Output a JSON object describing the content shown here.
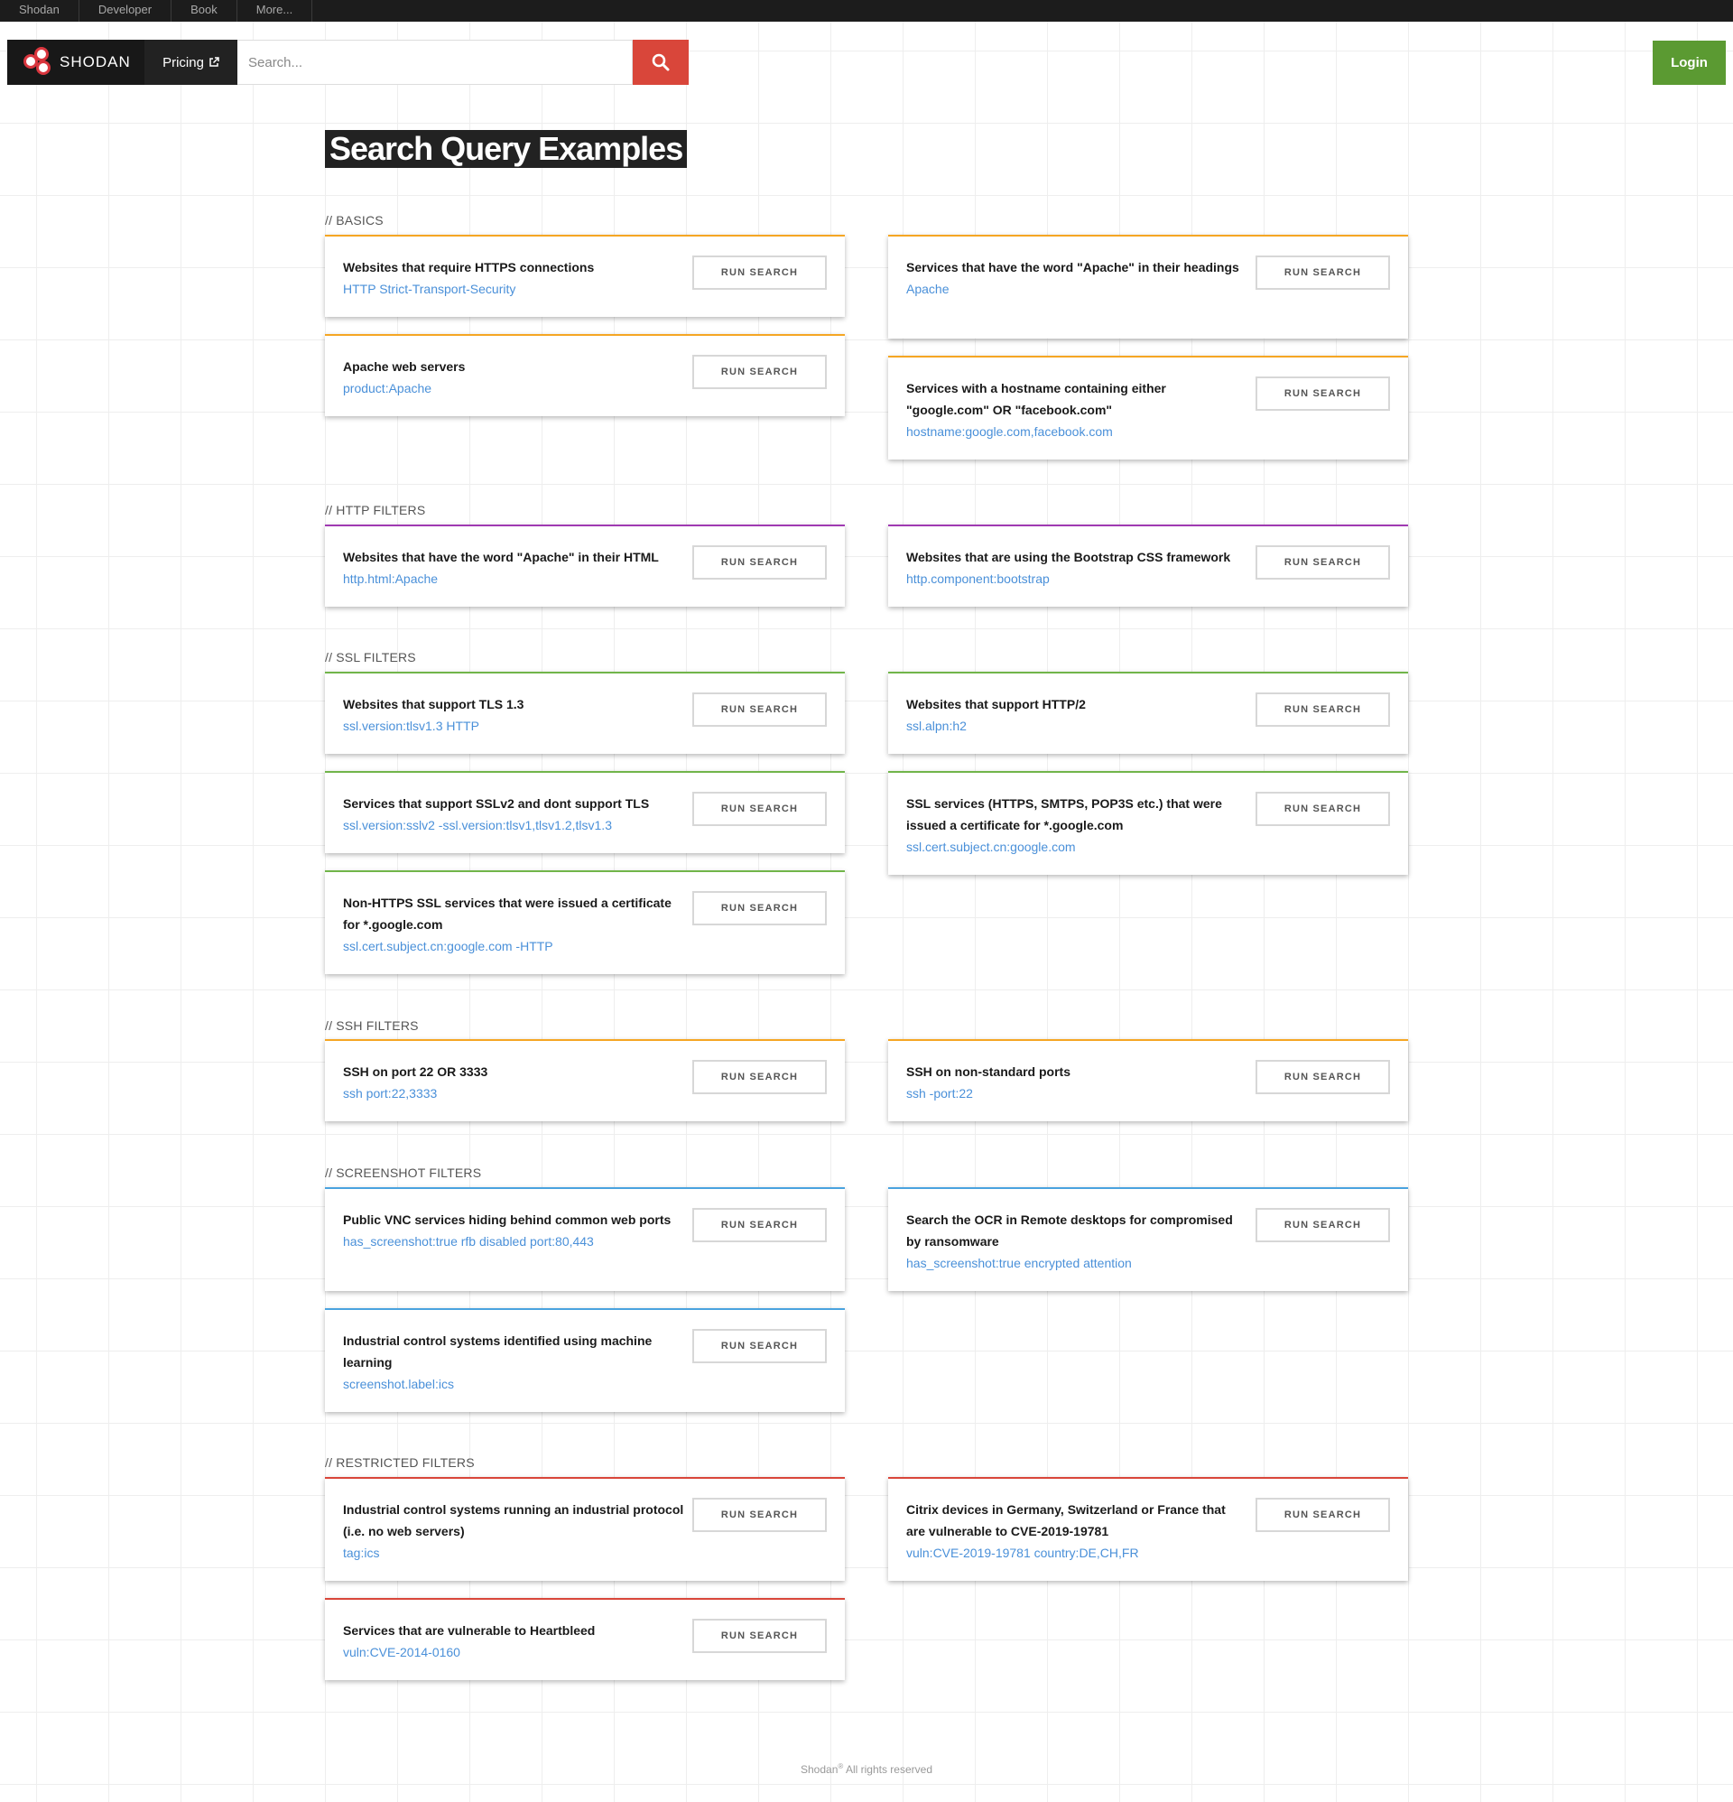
{
  "topnav": [
    "Shodan",
    "Developer",
    "Book",
    "More..."
  ],
  "header": {
    "brand": "SHODAN",
    "pricing": "Pricing",
    "search_placeholder": "Search...",
    "login": "Login"
  },
  "page_title": "Search Query Examples",
  "run_label": "RUN SEARCH",
  "colors": {
    "basics": "#f5a623",
    "http": "#a03ab2",
    "ssl": "#71b54a",
    "ssh": "#f5a623",
    "screenshot": "#4aa3df",
    "restricted": "#d9463a",
    "search_button": "#d9463a",
    "login_button": "#5b9a32",
    "query_link": "#4a90d9"
  },
  "sections": {
    "basics": "// BASICS",
    "http": "// HTTP FILTERS",
    "ssl": "// SSL FILTERS",
    "ssh": "// SSH FILTERS",
    "screenshot": "// SCREENSHOT FILTERS",
    "restricted": "// RESTRICTED FILTERS"
  },
  "cards": [
    {
      "title": "Websites that require HTTPS connections",
      "query": "HTTP Strict-Transport-Security"
    },
    {
      "title": "Apache web servers",
      "query": "product:Apache"
    },
    {
      "title": "Services that have the word \"Apache\" in their headings",
      "query": "Apache"
    },
    {
      "title": "Services with a hostname containing either \"google.com\" OR \"facebook.com\"",
      "query": "hostname:google.com,facebook.com"
    },
    {
      "title": "Websites that have the word \"Apache\" in their HTML",
      "query": "http.html:Apache"
    },
    {
      "title": "Websites that are using the Bootstrap CSS framework",
      "query": "http.component:bootstrap"
    },
    {
      "title": "Websites that support TLS 1.3",
      "query": "ssl.version:tlsv1.3 HTTP"
    },
    {
      "title": "Services that support SSLv2 and dont support TLS",
      "query": "ssl.version:sslv2 -ssl.version:tlsv1,tlsv1.2,tlsv1.3"
    },
    {
      "title": "Non-HTTPS SSL services that were issued a certificate for *.google.com",
      "query": "ssl.cert.subject.cn:google.com -HTTP"
    },
    {
      "title": "Websites that support HTTP/2",
      "query": "ssl.alpn:h2"
    },
    {
      "title": "SSL services (HTTPS, SMTPS, POP3S etc.) that were issued a certificate for *.google.com",
      "query": "ssl.cert.subject.cn:google.com"
    },
    {
      "title": "SSH on port 22 OR 3333",
      "query": "ssh port:22,3333"
    },
    {
      "title": "SSH on non-standard ports",
      "query": "ssh -port:22"
    },
    {
      "title": "Public VNC services hiding behind common web ports",
      "query": "has_screenshot:true rfb disabled port:80,443"
    },
    {
      "title": "Industrial control systems identified using machine learning",
      "query": "screenshot.label:ics"
    },
    {
      "title": "Search the OCR in Remote desktops for compromised by ransomware",
      "query": "has_screenshot:true encrypted attention"
    },
    {
      "title": "Industrial control systems running an industrial protocol (i.e. no web servers)",
      "query": "tag:ics"
    },
    {
      "title": "Services that are vulnerable to Heartbleed",
      "query": "vuln:CVE-2014-0160"
    },
    {
      "title": "Citrix devices in Germany, Switzerland or France that are vulnerable to CVE-2019-19781",
      "query": "vuln:CVE-2019-19781 country:DE,CH,FR"
    }
  ],
  "footer": {
    "brand": "Shodan",
    "mark": "®",
    "rights": " All rights reserved"
  }
}
